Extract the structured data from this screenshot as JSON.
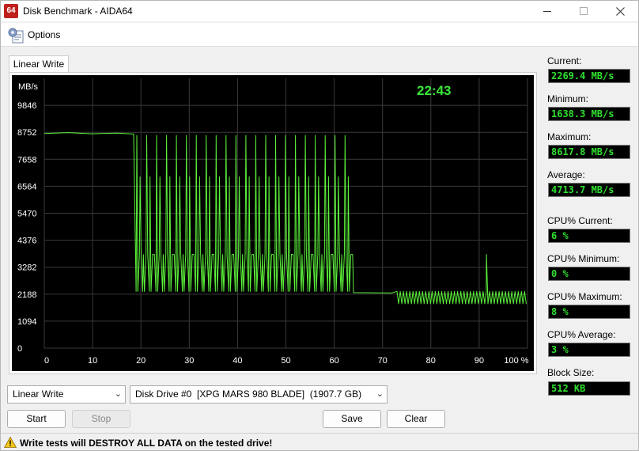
{
  "window": {
    "title": "Disk Benchmark - AIDA64",
    "app_icon": "64"
  },
  "menu": {
    "options_label": "Options"
  },
  "tab": {
    "label": "Linear Write"
  },
  "timer": "22:43",
  "chart_data": {
    "type": "line",
    "ylabel": "MB/s",
    "xlabel": "",
    "y_ticks": [
      0,
      1094,
      2188,
      3282,
      4376,
      5470,
      6564,
      7658,
      8752,
      9846
    ],
    "x_ticks": [
      "0",
      "10",
      "20",
      "30",
      "40",
      "50",
      "60",
      "70",
      "80",
      "90",
      "100 %"
    ],
    "ylim": [
      0,
      10940
    ],
    "xlim": [
      0,
      100
    ],
    "grid": true,
    "line_color": "#5cf23a",
    "series": [
      {
        "segment": "steady",
        "x": [
          0,
          5,
          10,
          15,
          18.5
        ],
        "y": [
          8700,
          8740,
          8690,
          8720,
          8680
        ]
      },
      {
        "segment": "oscillation",
        "x_range": [
          19,
          64
        ],
        "high": [
          8620,
          6950,
          3800
        ],
        "low": [
          2300,
          3800
        ]
      },
      {
        "segment": "low",
        "x": [
          64,
          72,
          73
        ],
        "y": [
          2250,
          2240,
          2300
        ]
      },
      {
        "segment": "ripple",
        "x_range": [
          73,
          100
        ],
        "y_band": [
          1800,
          2300
        ],
        "spike": {
          "x": 91.5,
          "y": 3800
        }
      }
    ]
  },
  "stats": {
    "current_label": "Current:",
    "current": "2269.4 MB/s",
    "minimum_label": "Minimum:",
    "minimum": "1638.3 MB/s",
    "maximum_label": "Maximum:",
    "maximum": "8617.8 MB/s",
    "average_label": "Average:",
    "average": "4713.7 MB/s",
    "cpu_current_label": "CPU% Current:",
    "cpu_current": "6 %",
    "cpu_minimum_label": "CPU% Minimum:",
    "cpu_minimum": "0 %",
    "cpu_maximum_label": "CPU% Maximum:",
    "cpu_maximum": "8 %",
    "cpu_average_label": "CPU% Average:",
    "cpu_average": "3 %",
    "block_size_label": "Block Size:",
    "block_size": "512 KB"
  },
  "controls": {
    "test_select": "Linear Write",
    "drive_select": "Disk Drive #0  [XPG MARS 980 BLADE]  (1907.7 GB)",
    "start": "Start",
    "stop": "Stop",
    "save": "Save",
    "clear": "Clear"
  },
  "status": {
    "warning": "Write tests will DESTROY ALL DATA on the tested drive!"
  }
}
